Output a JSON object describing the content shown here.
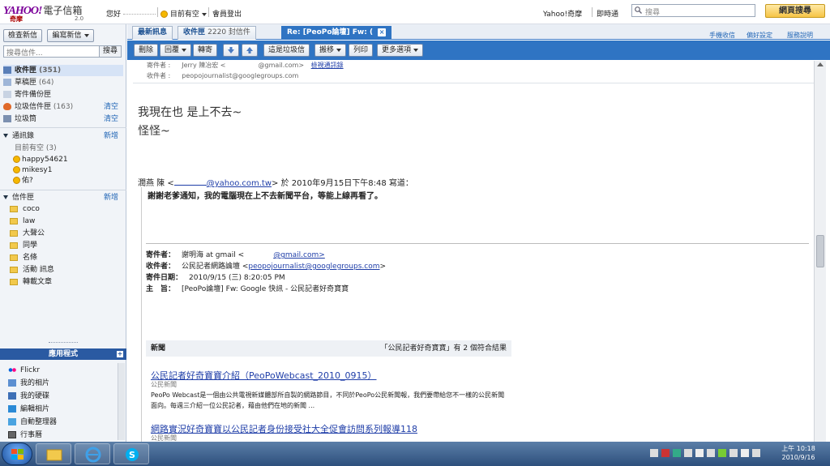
{
  "header": {
    "logo_text": "YAHOO!",
    "logo_cn": "電子信箱",
    "logo_sub": "奇摩",
    "logo_ver": "2.0",
    "greeting": "您好",
    "status": "目前有空",
    "signout": "會員登出",
    "yahoo_kimo": "Yahoo!奇摩",
    "messenger": "即時通",
    "search_placeholder": "搜尋",
    "web_search": "網頁搜尋"
  },
  "sidebar": {
    "check_mail": "檢查新信",
    "compose": "編寫新信",
    "search_placeholder": "搜尋信件...",
    "search_btn": "搜尋",
    "folders": [
      {
        "label": "收件匣",
        "count": "(351)"
      },
      {
        "label": "草稿匣",
        "count": "(64)"
      },
      {
        "label": "寄件備份匣",
        "count": ""
      },
      {
        "label": "垃圾信件匣",
        "count": "(163)",
        "action": "清空"
      },
      {
        "label": "垃圾筒",
        "count": "",
        "action": "清空"
      }
    ],
    "contacts_title": "通訊錄",
    "contacts_action": "新增",
    "online_label": "目前有空 (3)",
    "contacts": [
      "happy54621",
      "mikesy1",
      "佑?"
    ],
    "my_folders_title": "信件匣",
    "my_folders_action": "新增",
    "my_folders": [
      "coco",
      "law",
      "大聲公",
      "同學",
      "名條",
      "活動 訊息",
      "轉載文章"
    ],
    "apps_title": "應用程式",
    "apps": [
      "Flickr",
      "我的相片",
      "我的硬碟",
      "編輯相片",
      "自動整理器",
      "行事曆"
    ]
  },
  "tabs": [
    {
      "label": "最新訊息",
      "sub": ""
    },
    {
      "label": "收件匣",
      "sub": "2220 封信件"
    },
    {
      "label": "Re: [PeoPo論壇] Fw: (",
      "sub": ""
    }
  ],
  "right_links": [
    "手機收信",
    "偏好設定",
    "服務說明"
  ],
  "toolbar": {
    "delete": "刪除",
    "reply": "回覆",
    "forward": "轉寄",
    "spam": "這是垃圾信",
    "move": "搬移",
    "print": "列印",
    "more": "更多選項"
  },
  "message": {
    "from_label": "寄件者 :",
    "from_value": "Jerry 陳冶宏 <",
    "from_email": "@gmail.com>",
    "from_extra": "檢視通訊錄",
    "to_label": "收件者 :",
    "to_value": "peopojournalist@googlegroups.com",
    "body_line1": "我現在也 是上不去~",
    "body_line2": "怪怪~",
    "quote_prefix": "潤燕 陳 <",
    "quote_email": "@yahoo.com.tw",
    "quote_suffix": "> 於 2010年9月15日下午8:48 寫道：",
    "quote_text": "謝謝老爹通知，我的電腦現在上不去新聞平台，等能上線再看了。",
    "fwd_from_label": "寄件者：",
    "fwd_from_value": "謝明海 at gmail <",
    "fwd_from_email": "@gmail.com>",
    "fwd_to_label": "收件者：",
    "fwd_to_value": "公民記者網路論壇 <",
    "fwd_to_email": "peopojournalist@googlegroups.com",
    "fwd_to_end": ">",
    "fwd_date_label": "寄件日期：",
    "fwd_date_value": "2010/9/15 (三) 8:20:05 PM",
    "fwd_subject_label": "主　旨：",
    "fwd_subject_value": "[PeoPo論壇] Fw: Google 快訊 - 公民記者好奇寶寶",
    "news_label": "新聞",
    "news_result": "「公民記者好奇寶寶」有 2 個符合結果",
    "news1_title": "公民記者好奇寶寶介紹（PeoPoWebcast_2010_0915）",
    "news1_source": "公民新聞",
    "news1_body": "PeoPo Webcast是一個由公共電視新媒體部所自製的網路節目，不同於PeoPo公民新聞報，我們要帶給您不一樣的公民新聞面向。每週三介紹一位公民記者，藉由他們在地的新聞 ...",
    "news2_title": "網路實況好奇寶寶以公民記者身份接受社大全促會訪問系列報導118",
    "news2_source": "公民新聞"
  },
  "taskbar": {
    "time": "上午 10:18",
    "date": "2010/9/16"
  }
}
